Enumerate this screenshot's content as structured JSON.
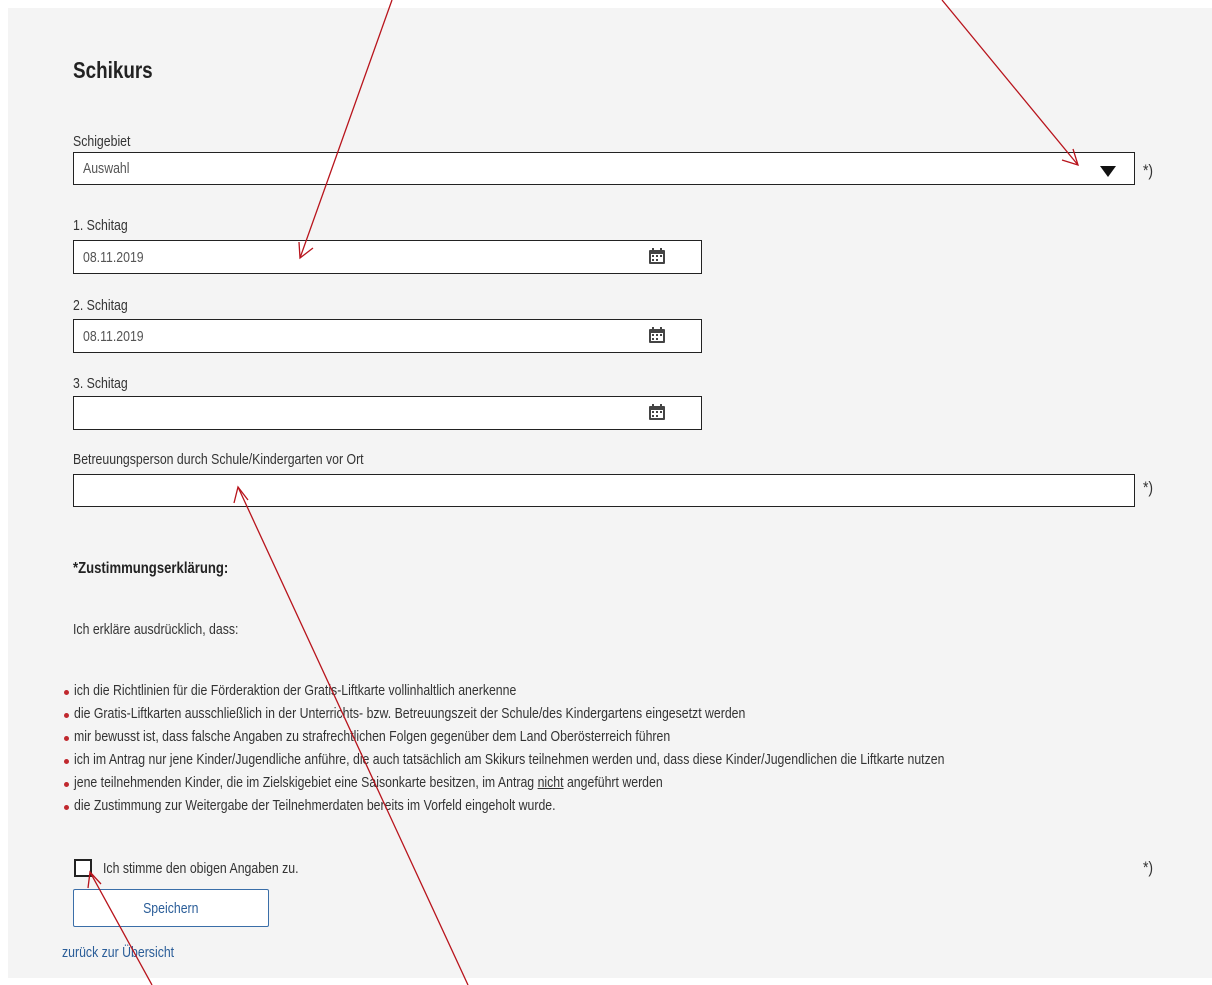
{
  "form": {
    "title": "Schikurs",
    "skiarea_label": "Schigebiet",
    "skiarea_value": "Auswahl",
    "day1_label": "1. Schitag",
    "day1_value": "08.11.2019",
    "day2_label": "2. Schitag",
    "day2_value": "08.11.2019",
    "day3_label": "3. Schitag",
    "day3_value": "",
    "supervisor_label": "Betreuungsperson durch Schule/Kindergarten vor Ort",
    "supervisor_value": "",
    "required_marker": "*)"
  },
  "consent": {
    "heading": "*Zustimmungserklärung:",
    "intro": "Ich erkläre ausdrücklich, dass:",
    "items": [
      "ich die Richtlinien für die Förderaktion der Gratis-Liftkarte vollinhaltlich anerkenne",
      "die Gratis-Liftkarten ausschließlich in der Unterrichts- bzw. Betreuungszeit der Schule/des Kindergartens eingesetzt werden",
      "mir bewusst ist, dass falsche Angaben zu strafrechtlichen Folgen gegenüber dem Land Oberösterreich führen",
      "ich im Antrag nur jene Kinder/Jugendliche anführe, die auch tatsächlich am Skikurs teilnehmen werden und, dass diese Kinder/Jugendlichen die Liftkarte nutzen",
      "die Zustimmung zur Weitergabe der Teilnehmerdaten bereits im Vorfeld eingeholt wurde."
    ],
    "item5_part1": "jene teilnehmenden Kinder, die im Zielskigebiet eine Saisonkarte besitzen, im Antrag ",
    "item5_underlined": "nicht",
    "item5_part2": " angeführt werden",
    "checkbox_label": "Ich stimme den obigen Angaben zu.",
    "checked": false
  },
  "actions": {
    "save_label": "Speichern",
    "back_link": "zurück zur Übersicht"
  },
  "icons": {
    "dropdown": "caret-down-icon",
    "calendar": "calendar-icon"
  },
  "colors": {
    "panel_bg": "#f4f4f4",
    "bullet": "#c0282e",
    "link": "#2a5d98",
    "annotation_arrow": "#b8141c"
  }
}
